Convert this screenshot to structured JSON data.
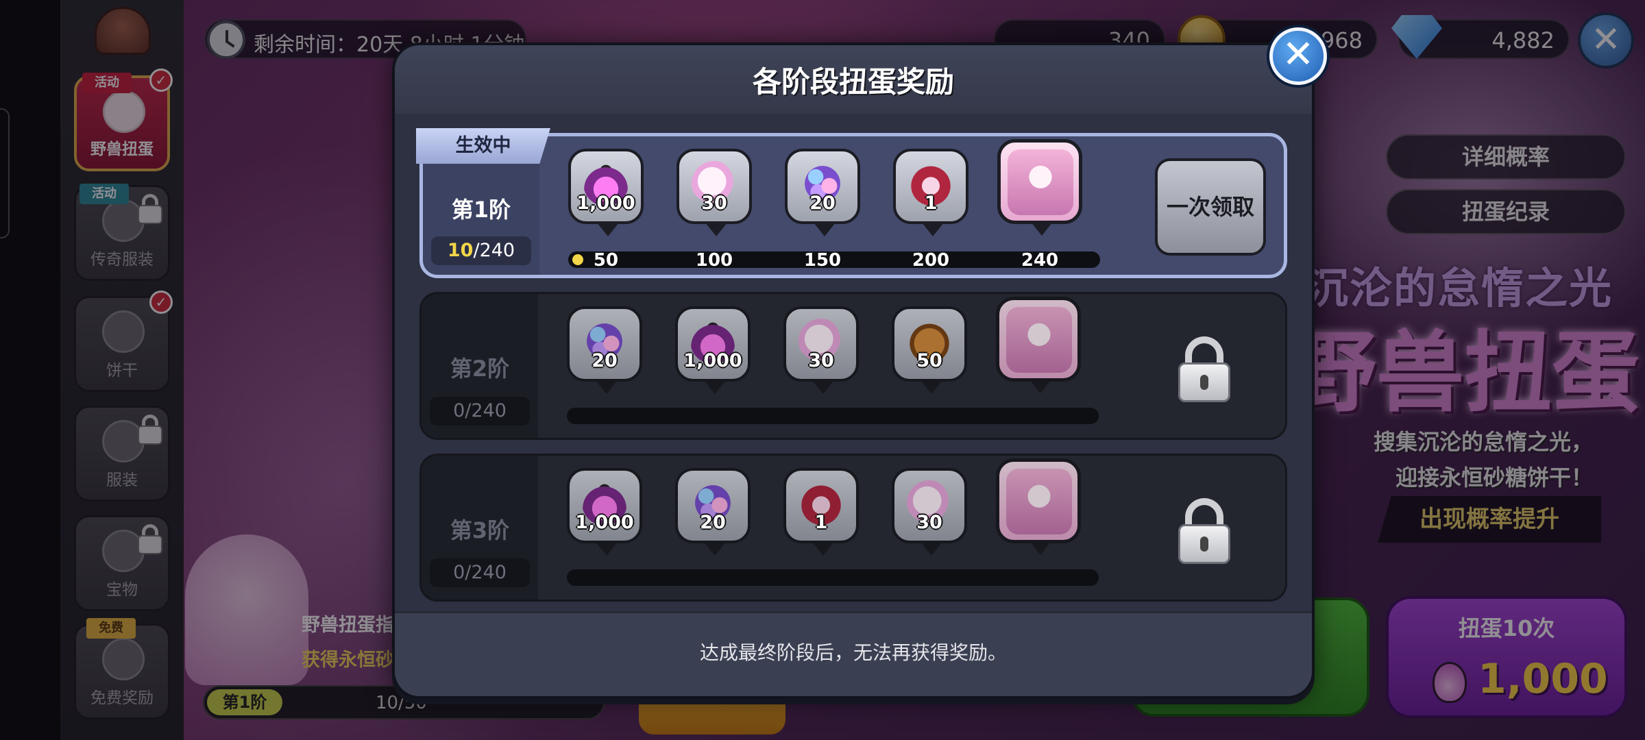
{
  "top_bar": {
    "timer_text": "剩余时间：20天 8小时 1分钟",
    "currency_1": "340",
    "currency_2": "968",
    "gems": "4,882"
  },
  "sidebar": {
    "items": [
      {
        "label": "野兽扭蛋",
        "ribbon": "活动",
        "active": true
      },
      {
        "label": "传奇服装",
        "ribbon": "活动",
        "locked": true
      },
      {
        "label": "饼干"
      },
      {
        "label": "服装",
        "locked": true
      },
      {
        "label": "宝物",
        "locked": true
      },
      {
        "label": "免费奖励",
        "ribbon": "免费"
      }
    ]
  },
  "right_panel": {
    "detail_rate": "详细概率",
    "gacha_log": "扭蛋纪录",
    "subtitle": "沉沦的怠惰之光",
    "title": "野兽扭蛋",
    "desc_line1": "搜集沉沦的怠惰之光，",
    "desc_line2": "迎接永恒砂糖饼干！",
    "rate_up": "出现概率提升",
    "pull10_label": "扭蛋10次",
    "pull10_cost": "1,000"
  },
  "bottom_left": {
    "banner_line1": "野兽扭蛋指",
    "banner_line2": "获得永恒砂",
    "stage": "第1阶",
    "count": "10/50"
  },
  "modal": {
    "title": "各阶段扭蛋奖励",
    "active_tag": "生效中",
    "footer_note": "达成最终阶段后，无法再获得奖励。",
    "claim_label": "一次领取",
    "tiers": [
      {
        "name": "第1阶",
        "progress_current": "10",
        "progress_total": "/240",
        "rewards": [
          {
            "item": "potion",
            "qty": "1,000"
          },
          {
            "item": "cookie-pink",
            "qty": "30"
          },
          {
            "item": "candy",
            "qty": "20"
          },
          {
            "item": "red-soul",
            "qty": "1"
          },
          {
            "item": "portrait",
            "qty": ""
          }
        ],
        "milestones": [
          "50",
          "100",
          "150",
          "200",
          "240"
        ],
        "progress_fraction": 0.042
      },
      {
        "name": "第2阶",
        "progress": "0/240",
        "rewards": [
          {
            "item": "candy",
            "qty": "20"
          },
          {
            "item": "potion",
            "qty": "1,000"
          },
          {
            "item": "cookie-pink",
            "qty": "30"
          },
          {
            "item": "brown",
            "qty": "50"
          },
          {
            "item": "portrait",
            "qty": ""
          }
        ]
      },
      {
        "name": "第3阶",
        "progress": "0/240",
        "rewards": [
          {
            "item": "potion",
            "qty": "1,000"
          },
          {
            "item": "candy",
            "qty": "20"
          },
          {
            "item": "red-soul",
            "qty": "1"
          },
          {
            "item": "cookie-pink",
            "qty": "30"
          },
          {
            "item": "portrait",
            "qty": ""
          }
        ]
      }
    ]
  }
}
